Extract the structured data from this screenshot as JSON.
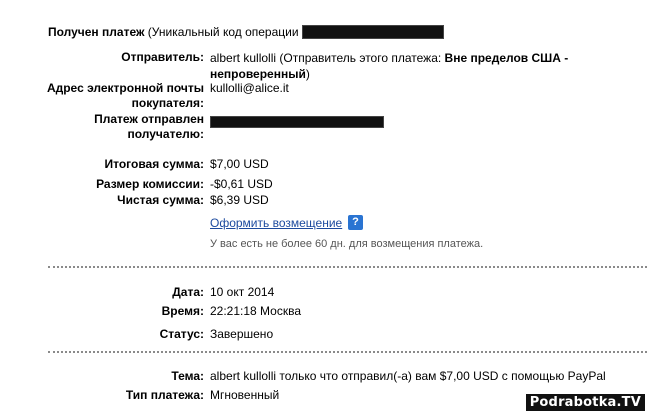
{
  "header": {
    "title_bold": "Получен платеж",
    "title_rest": " (Уникальный код операции"
  },
  "sender": {
    "label": "Отправитель:",
    "value_line1_a": "albert kullolli (Отправитель этого платежа: ",
    "value_line1_b": "Вне пределов США -",
    "value_line2": "непроверенный",
    "value_line2_end": ")"
  },
  "email": {
    "label_line1": "Адрес электронной почты",
    "label_line2": "покупателя:",
    "value": "kullolli@alice.it"
  },
  "recipient": {
    "label_line1": "Платеж отправлен",
    "label_line2": "получателю:"
  },
  "amounts": {
    "total_label": "Итоговая сумма:",
    "total_value": "$7,00 USD",
    "fee_label": "Размер комиссии:",
    "fee_value": "-$0,61 USD",
    "net_label": "Чистая сумма:",
    "net_value": "$6,39 USD"
  },
  "refund": {
    "link_label": "Оформить возмещение",
    "help_glyph": "?",
    "note": "У вас есть не более 60 дн. для возмещения платежа."
  },
  "details": {
    "date_label": "Дата:",
    "date_value": "10 окт 2014",
    "time_label": "Время:",
    "time_value": "22:21:18 Москва",
    "status_label": "Статус:",
    "status_value": "Завершено"
  },
  "subject": {
    "subject_label": "Тема:",
    "subject_value": "albert kullolli только что отправил(-а) вам $7,00 USD с помощью PayPal",
    "type_label": "Тип платежа:",
    "type_value": "Мгновенный"
  },
  "watermark": "Podrabotka.TV",
  "icons": {
    "help": "question-mark-icon"
  },
  "colors": {
    "link": "#1c4a9e",
    "help_icon": "#2a74d2",
    "redaction": "#111111"
  }
}
